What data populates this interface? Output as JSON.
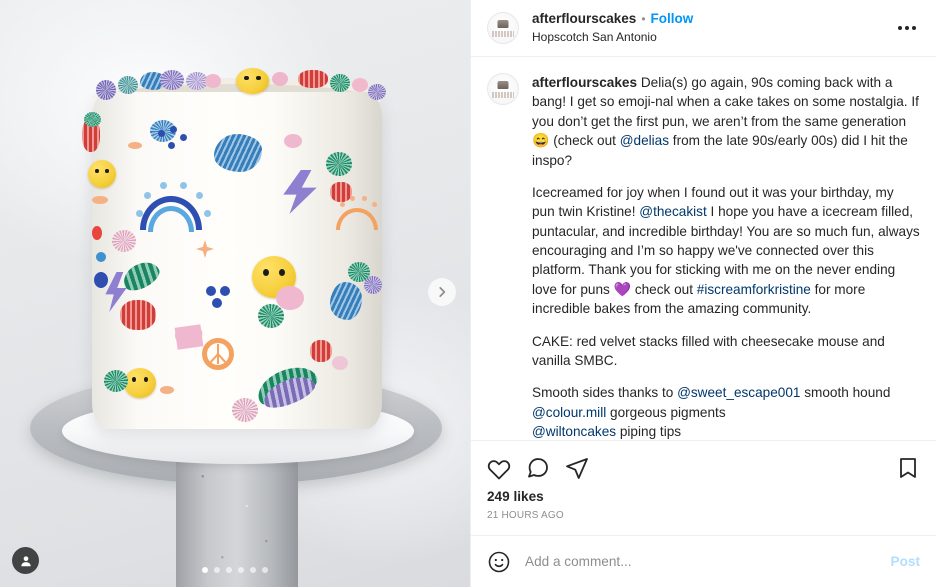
{
  "post": {
    "header": {
      "username": "afterflourscakes",
      "separator": "•",
      "follow_label": "Follow",
      "location": "Hopscotch San Antonio",
      "avatar_name": "profile-avatar",
      "more_options_name": "more-options-icon"
    },
    "caption": {
      "author": "afterflourscakes",
      "paragraphs": [
        {
          "segments": [
            {
              "type": "text",
              "value": "Delia(s) go again, 90s coming back with a bang! I get so emoji-nal when a cake takes on some nostalgia. If you don’t get the first pun, we aren’t from the same generation "
            },
            {
              "type": "emoji",
              "value": "😄"
            },
            {
              "type": "text",
              "value": " (check out "
            },
            {
              "type": "mention",
              "value": "@delias"
            },
            {
              "type": "text",
              "value": " from the late 90s/early 00s) did I hit the inspo?"
            }
          ]
        },
        {
          "segments": [
            {
              "type": "text",
              "value": "Icecreamed for joy when I found out it was your birthday, my pun twin Kristine! "
            },
            {
              "type": "mention",
              "value": "@thecakist"
            },
            {
              "type": "text",
              "value": " I hope you have a icecream filled, puntacular, and incredible birthday! You are so much fun, always encouraging and I’m so happy we've connected over this platform. Thank you for sticking with me on the never ending love for puns "
            },
            {
              "type": "emoji",
              "value": "💜"
            },
            {
              "type": "text",
              "value": " check out "
            },
            {
              "type": "hashtag",
              "value": "#iscreamforkristine"
            },
            {
              "type": "text",
              "value": " for more incredible bakes from the amazing community."
            }
          ]
        },
        {
          "segments": [
            {
              "type": "text",
              "value": "CAKE: red velvet stacks filled with cheesecake mouse and vanilla SMBC."
            }
          ]
        },
        {
          "segments": [
            {
              "type": "text",
              "value": "Smooth sides thanks to "
            },
            {
              "type": "mention",
              "value": "@sweet_escape001"
            },
            {
              "type": "text",
              "value": " smooth hound"
            },
            {
              "type": "break",
              "value": ""
            },
            {
              "type": "mention",
              "value": "@colour.mill"
            },
            {
              "type": "text",
              "value": " gorgeous pigments"
            },
            {
              "type": "break",
              "value": ""
            },
            {
              "type": "mention",
              "value": "@wiltoncakes"
            },
            {
              "type": "text",
              "value": " piping tips"
            }
          ]
        }
      ]
    },
    "actions": {
      "like_icon": "heart-icon",
      "comment_icon": "comment-icon",
      "share_icon": "share-icon",
      "save_icon": "bookmark-icon"
    },
    "likes_label": "249 likes",
    "likes_count": 249,
    "timestamp": "21 HOURS AGO",
    "composer": {
      "emoji_icon": "emoji-smiley-icon",
      "input_value": "",
      "placeholder": "Add a comment...",
      "post_label": "Post"
    }
  },
  "media": {
    "next_icon": "chevron-right-icon",
    "tag_icon": "person-tag-icon",
    "carousel": {
      "total": 6,
      "active_index": 0
    }
  },
  "colors": {
    "follow_blue": "#0095f6",
    "link_blue": "#00376b",
    "text_primary": "#262626",
    "text_secondary": "#8e8e8e",
    "border": "#efefef",
    "post_disabled": "#b2dffc"
  }
}
